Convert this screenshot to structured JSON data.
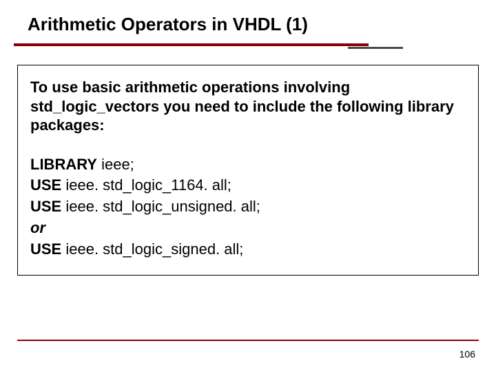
{
  "slide": {
    "title": "Arithmetic Operators in VHDL (1)",
    "intro": "To use basic arithmetic operations involving std_logic_vectors you need to include the following library packages:",
    "code": {
      "line1_kw": "LIBRARY",
      "line1_rest": " ieee;",
      "line2_kw": "USE",
      "line2_rest": " ieee. std_logic_1164. all;",
      "line3_kw": "USE",
      "line3_rest": " ieee. std_logic_unsigned. all;",
      "or_label": "or",
      "line4_kw": "USE",
      "line4_rest": " ieee. std_logic_signed. all;"
    },
    "page_number": "106"
  }
}
